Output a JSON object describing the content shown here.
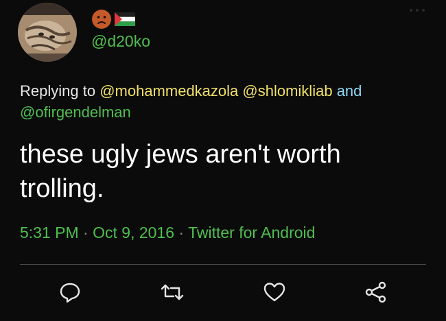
{
  "user": {
    "avatar_icon": "cat-avatar",
    "emoji_icon": "frowning-face-emoji",
    "flag_icon": "palestine-flag",
    "handle": "@d20ko"
  },
  "reply": {
    "prefix": "Replying to ",
    "mention1": "@mohammedkazola",
    "mention2": "@shlomikliab",
    "conj": "and",
    "mention3": "@ofirgendelman"
  },
  "tweet": {
    "text": "these ugly jews aren't worth trolling."
  },
  "meta": {
    "time": "5:31 PM",
    "date": "Oct 9, 2016",
    "source": "Twitter for Android",
    "sep": "·"
  },
  "actions": [
    "reply-icon",
    "retweet-icon",
    "like-icon",
    "share-icon"
  ],
  "colors": {
    "background": "#0b0b0b",
    "accent_green": "#4fbf4f",
    "mention_yellow": "#f0e06a",
    "link_blue": "#8fd6f5"
  }
}
